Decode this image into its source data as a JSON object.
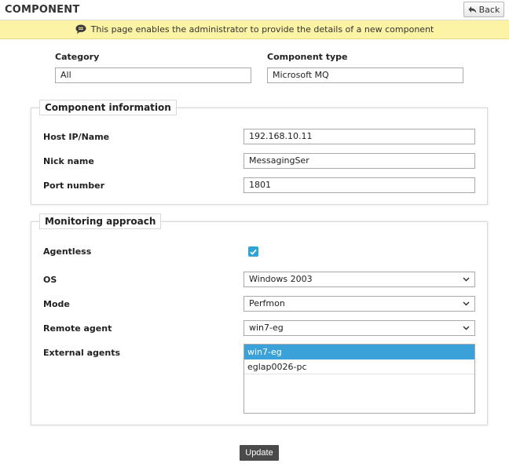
{
  "header": {
    "title": "COMPONENT",
    "back_label": "Back"
  },
  "info": {
    "message": "This page enables the administrator to provide the details of a new component"
  },
  "category": {
    "label": "Category",
    "value": "All"
  },
  "component_type": {
    "label": "Component type",
    "value": "Microsoft MQ"
  },
  "component_info": {
    "legend": "Component information",
    "host": {
      "label": "Host IP/Name",
      "value": "192.168.10.11"
    },
    "nick": {
      "label": "Nick name",
      "value": "MessagingSer"
    },
    "port": {
      "label": "Port number",
      "value": "1801"
    }
  },
  "monitoring": {
    "legend": "Monitoring approach",
    "agentless": {
      "label": "Agentless",
      "checked": true
    },
    "os": {
      "label": "OS",
      "value": "Windows 2003"
    },
    "mode": {
      "label": "Mode",
      "value": "Perfmon"
    },
    "remote_agent": {
      "label": "Remote agent",
      "value": "win7-eg"
    },
    "external_agents": {
      "label": "External agents",
      "options": [
        "win7-eg",
        "eglap0026-pc"
      ],
      "selected": "win7-eg"
    }
  },
  "actions": {
    "update_label": "Update"
  }
}
